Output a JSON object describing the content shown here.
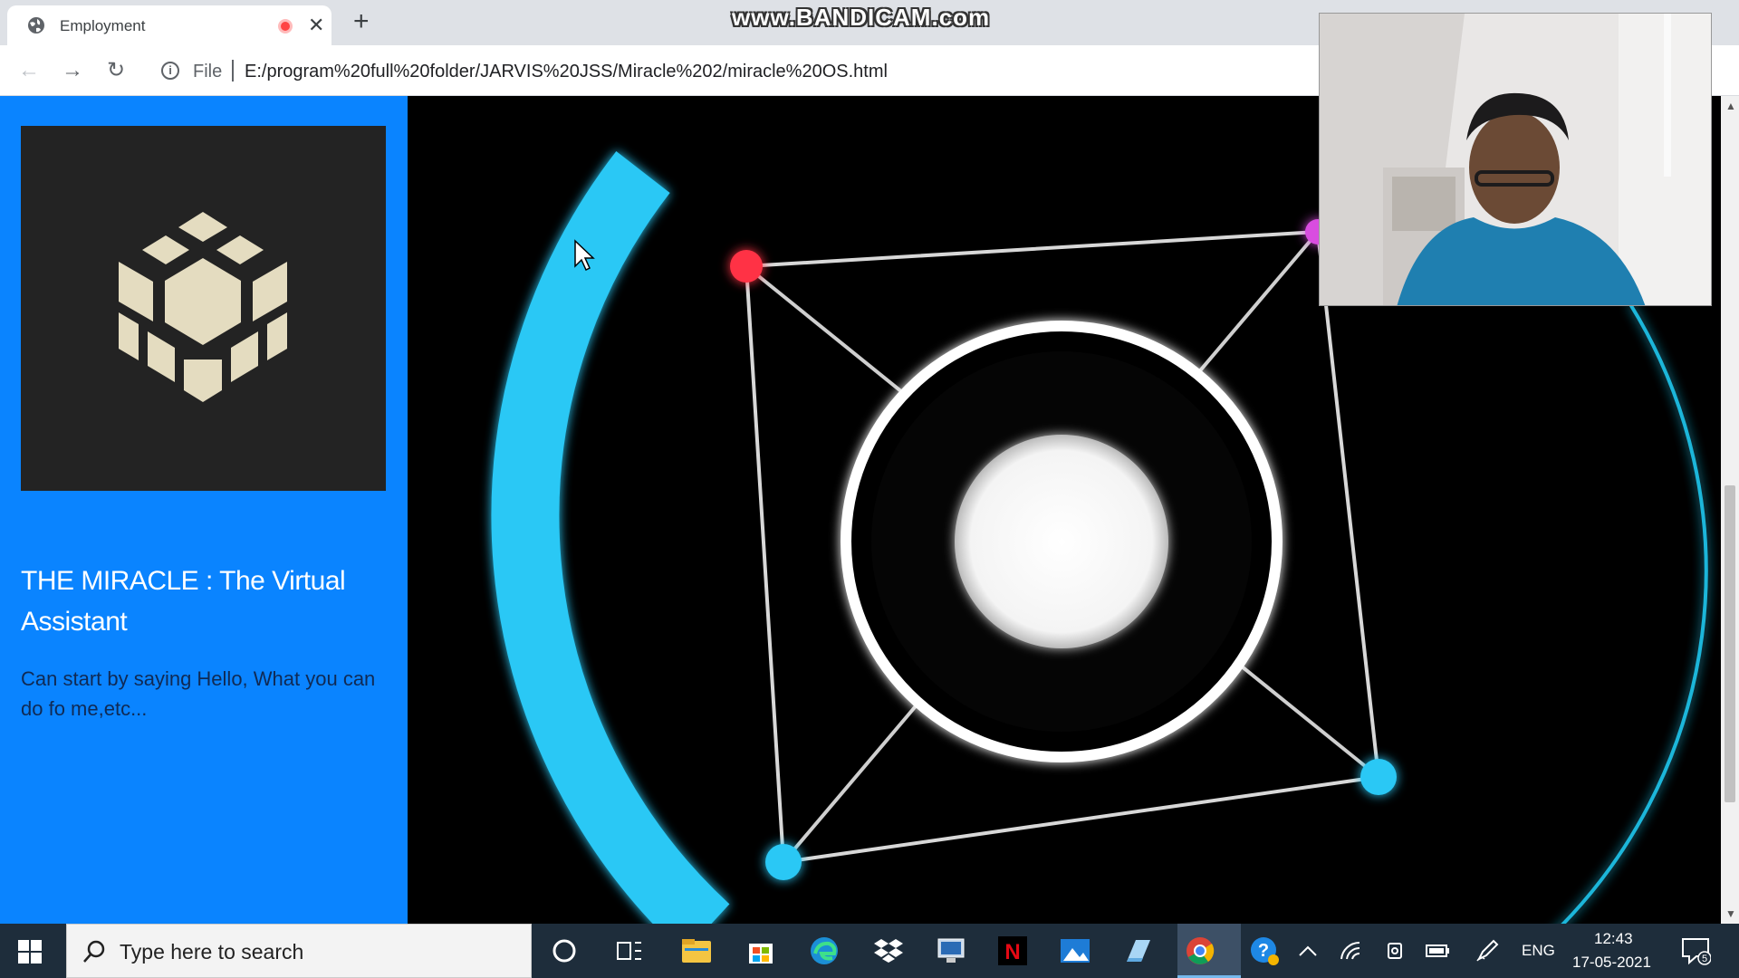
{
  "browser": {
    "tab_title": "Employment",
    "new_tab_label": "+",
    "close_label": "✕",
    "security_label": "File",
    "url": "E:/program%20full%20folder/JARVIS%20JSS/Miracle%202/miracle%20OS.html",
    "back_label": "←",
    "forward_label": "→",
    "reload_label": "↻"
  },
  "watermark": "www.BANDICAM.com",
  "sidebar": {
    "project_title": "THE MIRACLE : The Virtual Assistant",
    "project_description": "Can start by saying Hello, What you can do fo me,etc...",
    "logo_icon": "isometric-cube-icon"
  },
  "hud": {
    "accent_color": "#29c8f5",
    "node_colors": [
      "#ff3344",
      "#d94ee0",
      "#29c8f5",
      "#29c8f5"
    ]
  },
  "taskbar": {
    "search_placeholder": "Type here to search",
    "language": "ENG",
    "time": "12:43",
    "date": "17-05-2021",
    "notification_count": "5",
    "apps": [
      "cortana-icon",
      "task-view-icon",
      "file-explorer-icon",
      "store-icon",
      "edge-icon",
      "dropbox-icon",
      "network-app-icon",
      "netflix-icon",
      "photos-icon",
      "notepad-icon",
      "chrome-icon"
    ],
    "netflix_letter": "N"
  }
}
